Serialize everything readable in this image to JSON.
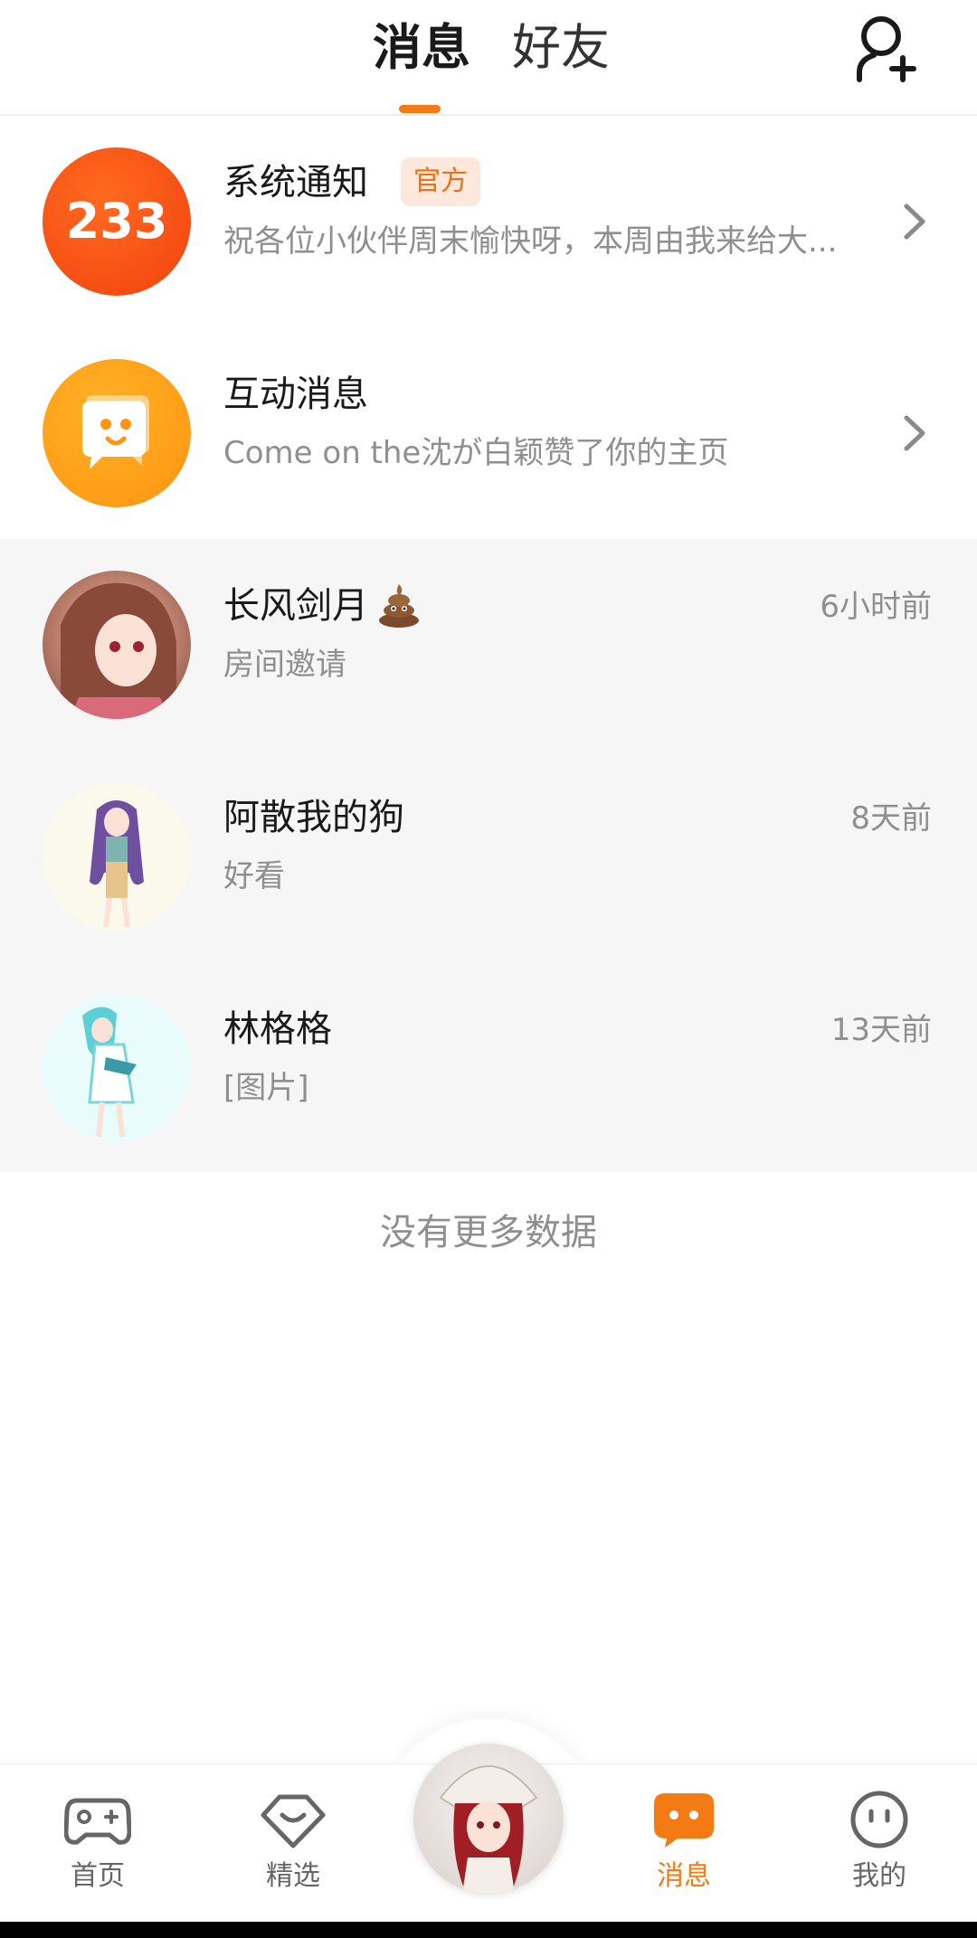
{
  "header": {
    "tabs": [
      {
        "label": "消息",
        "active": true
      },
      {
        "label": "好友",
        "active": false
      }
    ],
    "add_friend_icon": "add-user-icon",
    "accent_color": "#f47a14"
  },
  "system_rows": [
    {
      "title": "系统通知",
      "badge": "官方",
      "subtitle": "祝各位小伙伴周末愉快呀，本周由我来给大...",
      "avatar_text": "233"
    },
    {
      "title": "互动消息",
      "subtitle": "Come on the沈が白颖赞了你的主页"
    }
  ],
  "chats": [
    {
      "name": "长风剑月",
      "preview": "房间邀请",
      "time": "6小时前"
    },
    {
      "name": "阿散我的狗",
      "preview": "好看",
      "time": "8天前"
    },
    {
      "name": "林格格",
      "preview": "[图片]",
      "time": "13天前"
    }
  ],
  "footer_text": "没有更多数据",
  "bottom_nav": [
    {
      "label": "首页",
      "icon": "gamepad-icon",
      "active": false
    },
    {
      "label": "精选",
      "icon": "heart-diamond-icon",
      "active": false
    },
    {
      "label": "消息",
      "icon": "chat-bubble-icon",
      "active": true
    },
    {
      "label": "我的",
      "icon": "smiley-face-icon",
      "active": false
    }
  ]
}
